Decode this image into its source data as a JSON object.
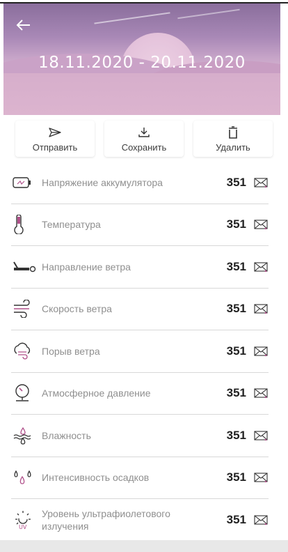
{
  "header": {
    "date_range": "18.11.2020 - 20.11.2020"
  },
  "actions": [
    {
      "label": "Отправить",
      "icon": "send-icon"
    },
    {
      "label": "Сохранить",
      "icon": "download-icon"
    },
    {
      "label": "Удалить",
      "icon": "trash-icon"
    }
  ],
  "rows": [
    {
      "label": "Напряжение аккумулятора",
      "value": "351",
      "icon": "battery-icon"
    },
    {
      "label": "Температура",
      "value": "351",
      "icon": "thermometer-icon"
    },
    {
      "label": "Направление ветра",
      "value": "351",
      "icon": "wind-direction-icon"
    },
    {
      "label": "Скорость ветра",
      "value": "351",
      "icon": "wind-speed-icon"
    },
    {
      "label": "Порыв ветра",
      "value": "351",
      "icon": "wind-gust-icon"
    },
    {
      "label": "Атмосферное давление",
      "value": "351",
      "icon": "pressure-gauge-icon"
    },
    {
      "label": "Влажность",
      "value": "351",
      "icon": "humidity-icon"
    },
    {
      "label": "Интенсивность осадков",
      "value": "351",
      "icon": "precipitation-icon"
    },
    {
      "label": "Уровень ультрафиолетового излучения",
      "value": "351",
      "icon": "uv-icon"
    }
  ],
  "colors": {
    "accent": "#b0508a",
    "header_top": "#8a6e9c",
    "header_bottom": "#d9b1cc"
  }
}
